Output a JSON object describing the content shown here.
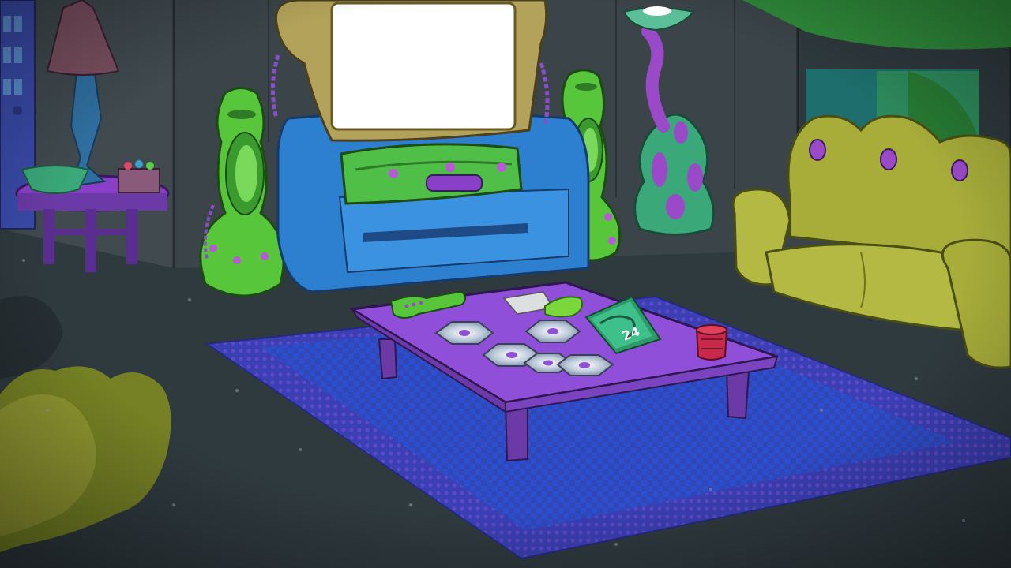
{
  "scene": {
    "room": "alien-lounge",
    "colors": {
      "wall": "#3b4549",
      "floor": "#2f3a3f",
      "rug_outer": "#3a3fb4",
      "rug_inner": "#2c4fd0",
      "table_top": "#8f4fd8",
      "table_leg": "#6b3aa6",
      "sofa": "#a8ad3a",
      "sofa_shadow": "#7e8a22",
      "tv_frame": "#b3a35a",
      "tv_screen": "#ffffff",
      "tv_base": "#2d7fd0",
      "speaker": "#58c63a",
      "accent_purple": "#8a3fc8"
    },
    "objects": [
      {
        "name": "tv-screen",
        "interactable": true
      },
      {
        "name": "sofa-right",
        "interactable": true
      },
      {
        "name": "coffee-table",
        "interactable": true
      },
      {
        "name": "game-case-24",
        "interactable": true
      },
      {
        "name": "remote-control",
        "interactable": true
      },
      {
        "name": "cup",
        "interactable": true
      }
    ],
    "game_case_label": "24"
  }
}
